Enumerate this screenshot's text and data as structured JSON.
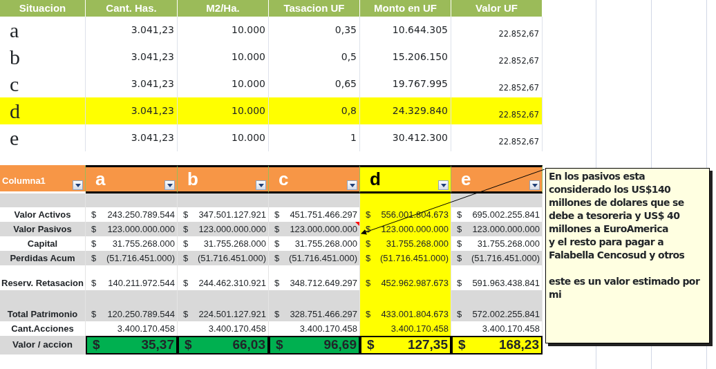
{
  "top_table": {
    "columns": [
      "Situacion",
      "Cant. Has.",
      "M2/Ha.",
      "Tasacion UF",
      "Monto en UF",
      "Valor UF"
    ],
    "rows": [
      {
        "cells": [
          "a",
          "3.041,23",
          "10.000",
          "0,35",
          "10.644.305",
          "22.852,67"
        ],
        "highlighted": false
      },
      {
        "cells": [
          "b",
          "3.041,23",
          "10.000",
          "0,5",
          "15.206.150",
          "22.852,67"
        ],
        "highlighted": false
      },
      {
        "cells": [
          "c",
          "3.041,23",
          "10.000",
          "0,65",
          "19.767.995",
          "22.852,67"
        ],
        "highlighted": false
      },
      {
        "cells": [
          "d",
          "3.041,23",
          "10.000",
          "0,8",
          "24.329.840",
          "22.852,67"
        ],
        "highlighted": true
      },
      {
        "cells": [
          "e",
          "3.041,23",
          "10.000",
          "1",
          "30.412.300",
          "22.852,67"
        ],
        "highlighted": false
      }
    ]
  },
  "bottom_table": {
    "columns": [
      {
        "label": "Columna1",
        "highlighted": false
      },
      {
        "label": "a",
        "highlighted": false
      },
      {
        "label": "b",
        "highlighted": false
      },
      {
        "label": "c",
        "highlighted": false
      },
      {
        "label": "d",
        "highlighted": true
      },
      {
        "label": "e",
        "highlighted": false
      }
    ],
    "rows": [
      {
        "kind": "blank",
        "shaded": true
      },
      {
        "kind": "money",
        "label": "Valor Activos",
        "shaded": false,
        "spaced": false,
        "cells": [
          {
            "symbol": "$",
            "amount": "243.250.789.544"
          },
          {
            "symbol": "$",
            "amount": "347.501.127.921"
          },
          {
            "symbol": "$",
            "amount": "451.751.466.297"
          },
          {
            "symbol": "$",
            "amount": "556.001.804.673"
          },
          {
            "symbol": "$",
            "amount": "695.002.255.841"
          }
        ]
      },
      {
        "kind": "money",
        "label": "Valor Pasivos",
        "shaded": true,
        "spaced": false,
        "cells": [
          {
            "symbol": "$",
            "amount": "123.000.000.000"
          },
          {
            "symbol": "$",
            "amount": "123.000.000.000"
          },
          {
            "symbol": "$",
            "amount": "123.000.000.000",
            "commented": true
          },
          {
            "symbol": "$",
            "amount": "123.000.000.000"
          },
          {
            "symbol": "$",
            "amount": "123.000.000.000"
          }
        ]
      },
      {
        "kind": "money",
        "label": "Capital",
        "shaded": false,
        "spaced": false,
        "cells": [
          {
            "symbol": "$",
            "amount": "31.755.268.000"
          },
          {
            "symbol": "$",
            "amount": "31.755.268.000"
          },
          {
            "symbol": "$",
            "amount": "31.755.268.000"
          },
          {
            "symbol": "$",
            "amount": "31.755.268.000"
          },
          {
            "symbol": "$",
            "amount": "31.755.268.000"
          }
        ]
      },
      {
        "kind": "money",
        "label": "Perdidas Acum",
        "shaded": true,
        "spaced": false,
        "cells": [
          {
            "symbol": "$",
            "amount": "(51.716.451.000)"
          },
          {
            "symbol": "$",
            "amount": "(51.716.451.000)"
          },
          {
            "symbol": "$",
            "amount": "(51.716.451.000)"
          },
          {
            "symbol": "$",
            "amount": "(51.716.451.000)"
          },
          {
            "symbol": "$",
            "amount": "(51.716.451.000)"
          }
        ]
      },
      {
        "kind": "money",
        "label": "Reserv. Retasacion",
        "shaded": false,
        "spaced": true,
        "cells": [
          {
            "symbol": "$",
            "amount": "140.211.972.544"
          },
          {
            "symbol": "$",
            "amount": "244.462.310.921"
          },
          {
            "symbol": "$",
            "amount": "348.712.649.297"
          },
          {
            "symbol": "$",
            "amount": "452.962.987.673"
          },
          {
            "symbol": "$",
            "amount": "591.963.438.841"
          }
        ]
      },
      {
        "kind": "money",
        "label": "Total Patrimonio",
        "shaded": true,
        "spaced": true,
        "cells": [
          {
            "symbol": "$",
            "amount": "120.250.789.544"
          },
          {
            "symbol": "$",
            "amount": "224.501.127.921"
          },
          {
            "symbol": "$",
            "amount": "328.751.466.297"
          },
          {
            "symbol": "$",
            "amount": "433.001.804.673"
          },
          {
            "symbol": "$",
            "amount": "572.002.255.841"
          }
        ]
      },
      {
        "kind": "plain",
        "label": "Cant.Acciones",
        "shaded": false,
        "spaced": false,
        "cells": [
          {
            "amount": "3.400.170.458"
          },
          {
            "amount": "3.400.170.458"
          },
          {
            "amount": "3.400.170.458"
          },
          {
            "amount": "3.400.170.458"
          },
          {
            "amount": "3.400.170.458"
          }
        ]
      },
      {
        "kind": "result",
        "label": "Valor / accion",
        "shaded": true,
        "spaced": false,
        "cells": [
          {
            "symbol": "$",
            "amount": "35,37",
            "color": "#00b050"
          },
          {
            "symbol": "$",
            "amount": "66,03",
            "color": "#00b050"
          },
          {
            "symbol": "$",
            "amount": "96,69",
            "color": "#00b050"
          },
          {
            "symbol": "$",
            "amount": "127,35",
            "color": "#ffff00"
          },
          {
            "symbol": "$",
            "amount": "168,23",
            "color": "#ffff00"
          }
        ]
      }
    ]
  },
  "comment": {
    "text": "En los pasivos esta\nconsiderado los US$140\nmillones de dolares que se\ndebe a tesoreria y US$ 40\nmillones a EuroAmerica\ny el resto para pagar a\nFalabella Cencosud y otros\n\neste es un valor estimado por\nmi"
  }
}
